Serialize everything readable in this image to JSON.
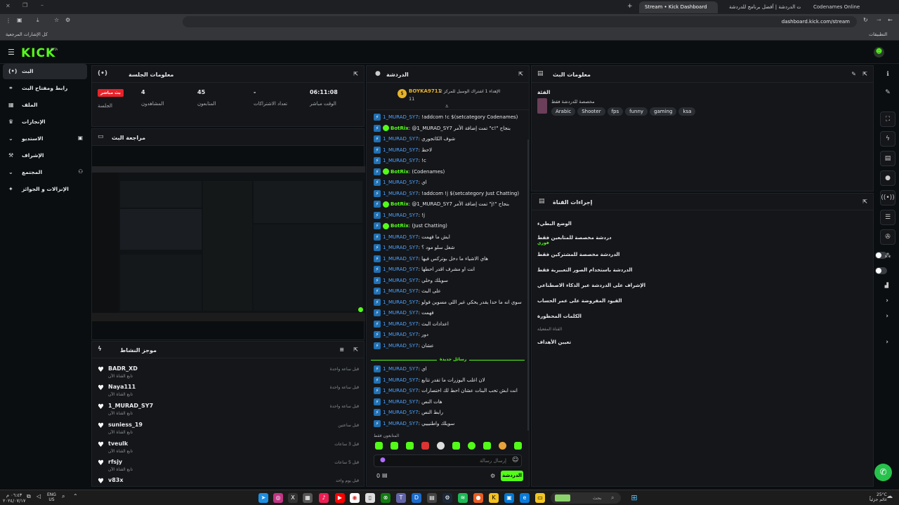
{
  "browser": {
    "tabs": [
      "Codenames Online",
      "بوت الدردشة | أفضل برنامج للدردشة",
      "Stream • Kick Dashboard"
    ],
    "url": "dashboard.kick.com/stream",
    "bookmarks_right": "التطبيقات",
    "bookmarks_left": "كل الإشارات المرجعية"
  },
  "brand": {
    "logo": "KICK",
    "beta": "BETA",
    "accent": "#53fc18"
  },
  "sidebar": {
    "items": [
      {
        "label": "البث",
        "icon": "live-icon"
      },
      {
        "label": "رابط ومفتاح البث",
        "icon": "link-icon"
      },
      {
        "label": "الملف",
        "icon": "library-icon"
      },
      {
        "label": "الإنجازات",
        "icon": "trophy-icon"
      },
      {
        "label": "الاستديو",
        "icon": "chevron-down-icon"
      },
      {
        "label": "الإشراف",
        "icon": "hammer-icon"
      },
      {
        "label": "المجتمع",
        "icon": "chevron-down-icon"
      },
      {
        "label": "الإنزالات و الجوائز",
        "icon": "gift-icon"
      }
    ]
  },
  "session": {
    "title": "معلومات الجلسة",
    "live_badge": "بث مباشر",
    "session_label": "الجلسة",
    "stats": [
      {
        "value": "06:11:08",
        "label": "الوقت مباشر"
      },
      {
        "value": "-",
        "label": "تعداد الاشتراكات"
      },
      {
        "value": "45",
        "label": "المتابعون"
      },
      {
        "value": "4",
        "label": "المشاهدون"
      }
    ]
  },
  "preview": {
    "title": "مراجعة البث"
  },
  "activity": {
    "title": "موجز النشاط",
    "items": [
      {
        "name": "BADR_XD",
        "sub": "تابع القناة الآن",
        "time": "قبل ساعة واحدة"
      },
      {
        "name": "Naya111",
        "sub": "تابع القناة الآن",
        "time": "قبل ساعة واحدة"
      },
      {
        "name": "1_MURAD_SY7",
        "sub": "تابع القناة الآن",
        "time": "قبل ساعة واحدة"
      },
      {
        "name": "suniess_19",
        "sub": "تابع القناة الآن",
        "time": "قبل ساعتين"
      },
      {
        "name": "tveulk",
        "sub": "تابع القناة الآن",
        "time": "قبل 3 ساعات"
      },
      {
        "name": "rfsjy",
        "sub": "تابع القناة الآن",
        "time": "قبل 5 ساعات"
      },
      {
        "name": "v83x",
        "sub": "",
        "time": "قبل يوم واحد"
      }
    ]
  },
  "chat": {
    "title": "الدردشة",
    "pinned_user": "BOYKA9711",
    "pinned_text": "الإهداء 1 اشتراك الوسيل للمركز 2",
    "pinned_count": "11",
    "lines": [
      {
        "user": "1_MURAD_SY7",
        "text": ": !addcom !c $(setcategory Codenames)",
        "bot": false
      },
      {
        "user": "BotRix",
        "text": ": @1_MURAD_SY7 تمت إضافة الأمر \"c!\" بنجاح",
        "bot": true
      },
      {
        "user": "1_MURAD_SY7",
        "text": ": شوف الكاتجوري",
        "bot": false
      },
      {
        "user": "1_MURAD_SY7",
        "text": ": لاحظ",
        "bot": false
      },
      {
        "user": "1_MURAD_SY7",
        "text": ": !c",
        "bot": false
      },
      {
        "user": "BotRix",
        "text": ": (Codenames)",
        "bot": true
      },
      {
        "user": "1_MURAD_SY7",
        "text": ": اي",
        "bot": false
      },
      {
        "user": "1_MURAD_SY7",
        "text": ": !addcom !j $(setcategory Just Chatting)",
        "bot": false
      },
      {
        "user": "BotRix",
        "text": ": @1_MURAD_SY7 تمت إضافة الأمر \"j!\" بنجاح",
        "bot": true
      },
      {
        "user": "1_MURAD_SY7",
        "text": ": !j",
        "bot": false
      },
      {
        "user": "BotRix",
        "text": ": (Just Chatting)",
        "bot": true
      },
      {
        "user": "1_MURAD_SY7",
        "text": ": ايش ما فهمت",
        "bot": false
      },
      {
        "user": "1_MURAD_SY7",
        "text": ": شغل سلو مود ؟",
        "bot": false
      },
      {
        "user": "1_MURAD_SY7",
        "text": ": هاي الاشياء ما دخل بوتركس فيها",
        "bot": false
      },
      {
        "user": "1_MURAD_SY7",
        "text": ": انت او مشرف اقدر احطها",
        "bot": false
      },
      {
        "user": "1_MURAD_SY7",
        "text": ": سويلك وحلي",
        "bot": false
      },
      {
        "user": "1_MURAD_SY7",
        "text": ": على البث",
        "bot": false
      },
      {
        "user": "1_MURAD_SY7",
        "text": ": سوي انه ما حدا يقدر يحكي غير اللي مسوين فولو",
        "bot": false
      },
      {
        "user": "1_MURAD_SY7",
        "text": ": فهمت",
        "bot": false
      },
      {
        "user": "1_MURAD_SY7",
        "text": ": اعدادات البث",
        "bot": false
      },
      {
        "user": "1_MURAD_SY7",
        "text": ": دور",
        "bot": false
      },
      {
        "user": "1_MURAD_SY7",
        "text": ": عشان",
        "bot": false
      }
    ],
    "new_messages_label": "رسائل جديدة",
    "lines_after": [
      {
        "user": "1_MURAD_SY7",
        "text": ": اي",
        "bot": false
      },
      {
        "user": "1_MURAD_SY7",
        "text": ": لان اغلب اليوزرات ما تقدر تتابع",
        "bot": false
      },
      {
        "user": "1_MURAD_SY7",
        "text": ": انت ابش تحب البنات عشان احط لك اختصارات",
        "bot": false
      },
      {
        "user": "1_MURAD_SY7",
        "text": ": هات النص",
        "bot": false
      },
      {
        "user": "1_MURAD_SY7",
        "text": ": رابط النص",
        "bot": false
      },
      {
        "user": "1_MURAD_SY7",
        "text": ": سويلك واطنيييي",
        "bot": false
      }
    ],
    "followers_only": "المتابعون فقط",
    "input_placeholder": "إرسال رسالة",
    "send_label": "الدردشة",
    "viewer_count": "0"
  },
  "stream_info": {
    "title": "معلومات البث",
    "category_label": "الفئة",
    "category_sub": "مخصصة للدردشة فقط",
    "tags": [
      "ksa",
      "gaming",
      "funny",
      "fps",
      "Shooter",
      "Arabic"
    ]
  },
  "channel_actions": {
    "title": "إجراءات القناة",
    "rows": [
      {
        "label": "الوضع البطيء",
        "type": "chevron"
      },
      {
        "label": "دردشة مخصصة للمتابعين فقط",
        "sub": "فوري",
        "type": "chevron"
      },
      {
        "label": "الدردشة مخصصة للمشتركين فقط",
        "type": "toggle"
      },
      {
        "label": "الدردشة باستخدام الصور التعبيرية فقط",
        "type": "toggle"
      },
      {
        "label": "الإشراف على الدردشة عبر الذكاء الاصطناعي",
        "type": "icon"
      },
      {
        "label": "القيود المفروضة على عمر الحساب",
        "type": "chevron"
      },
      {
        "label": "الكلمات المحظورة",
        "type": "chevron"
      }
    ],
    "section_label": "القناة المفعيلة",
    "goals_label": "تعيين الأهداف"
  },
  "taskbar": {
    "weather": "25°C",
    "weather_sub": "غائم جزئياً",
    "lang": "ENG",
    "region": "US",
    "time": "٠٦:٤٣ م",
    "date": "٢٠٢٤/٠٧/١٧",
    "search_placeholder": "بحث"
  }
}
